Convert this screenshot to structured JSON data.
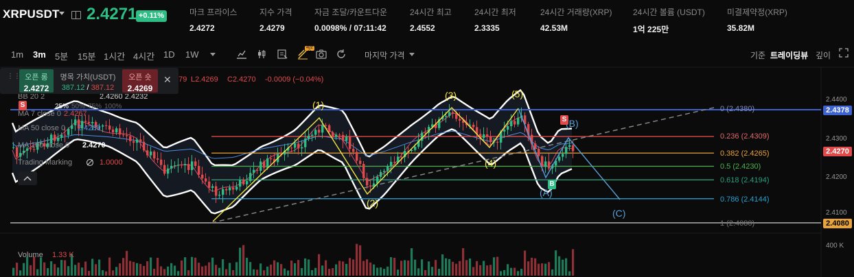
{
  "header": {
    "symbol": "XRPUSDT",
    "price": "2.4271",
    "change": "+0.11%",
    "stats": [
      {
        "key": "마크 프라이스",
        "value": "2.4272"
      },
      {
        "key": "지수 가격",
        "value": "2.4279"
      },
      {
        "key": "자금 조달/카운트다운",
        "value": "0.0098% / 07:11:42"
      },
      {
        "key": "24시간 최고",
        "value": "2.4552"
      },
      {
        "key": "24시간 최저",
        "value": "2.3335"
      },
      {
        "key": "24시간 거래량(XRP)",
        "value": "42.53M"
      },
      {
        "key": "24시간 볼륨 (USDT)",
        "value": "1억 225만"
      },
      {
        "key": "미결제약정(XRP)",
        "value": "35.82M"
      }
    ]
  },
  "toolbar": {
    "timeframes": [
      "1m",
      "3m",
      "5분",
      "15분",
      "1시간",
      "4시간",
      "1D",
      "1W"
    ],
    "active_timeframe": "3m",
    "price_type": "마지막 가격",
    "views": [
      "기준",
      "트레이딩뷰",
      "깊이"
    ],
    "active_view": "트레이딩뷰",
    "new_badge": "새로운"
  },
  "order_panel": {
    "open_long_label": "오픈 롱",
    "open_long_price": "2.4272",
    "notional_label": "명목 가치(USDT)",
    "notional_long": "387.12",
    "notional_sep": "/",
    "notional_short": "387.12",
    "open_short_label": "오픈 숏",
    "open_short_price": "2.4269",
    "pcts": [
      "25%",
      "50%",
      "75%",
      "100%"
    ]
  },
  "legend": {
    "ohlc_tail": "279",
    "low": "L2.4269",
    "close": "C2.4270",
    "change": "-0.0009 (−0.04%)",
    "bb": "BB 20 2",
    "bb_values": "2.4260  2.4232",
    "ma7": "MA 7 close 0",
    "ma7_value": "2.4267",
    "ma50": "MA 50 close 0",
    "ma50_value": "2.4289",
    "ma100": "MA 100 close 0",
    "ma100_value": "2.4270",
    "trading_marking": "Trading Marking",
    "trading_marking_value": "1.0000",
    "volume": "Volume",
    "volume_value": "1.33 K"
  },
  "fib_levels": [
    {
      "label": "0 (2.4380)",
      "color": "#3d63d1"
    },
    {
      "label": "0.236 (2.4309)",
      "color": "#e04a4a"
    },
    {
      "label": "0.382 (2.4265)",
      "color": "#e8a33a"
    },
    {
      "label": "0.5 (2.4230)",
      "color": "#4fb04f"
    },
    {
      "label": "0.618 (2.4194)",
      "color": "#2a9f7c"
    },
    {
      "label": "0.786 (2.4144)",
      "color": "#2b9fd0"
    },
    {
      "label": "1 (2.4080)",
      "color": "#888888"
    }
  ],
  "wave_labels": [
    "(1)",
    "(2)",
    "(3)",
    "(4)",
    "(5)",
    "(A)",
    "(B)",
    "(C)"
  ],
  "markers": {
    "buy": "B",
    "sell": "S",
    "sell_left": "S"
  },
  "price_axis": {
    "ticks": [
      "2.4400",
      "2.4300",
      "2.4200",
      "2.4100"
    ],
    "volume_tick": "400 K",
    "tag_high": "2.4378",
    "tag_last": "2.4270",
    "tag_low": "2.4080"
  },
  "colors": {
    "up": "#2ebd85",
    "down": "#e04a4a",
    "wave": "#f5e642",
    "abc": "#5aa0d8"
  }
}
